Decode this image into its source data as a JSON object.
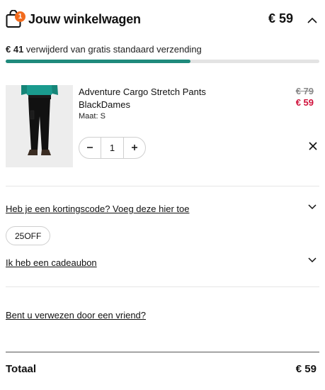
{
  "header": {
    "badge_count": "1",
    "title": "Jouw winkelwagen",
    "total": "€ 59",
    "collapse_icon": "chevron-up-icon"
  },
  "shipping": {
    "amount": "€ 41",
    "message": " verwijderd van gratis standaard verzending",
    "progress_fraction": 0.59,
    "progress_color": "#1f8a7c"
  },
  "item": {
    "name": "Adventure Cargo Stretch Pants BlackDames",
    "size": "Maat: S",
    "price_old": "€ 79",
    "price_new": "€ 59",
    "quantity": "1",
    "decrement_icon": "minus-icon",
    "increment_icon": "plus-icon",
    "remove_icon": "close-icon"
  },
  "discount": {
    "link": "Heb je een kortingscode? Voeg deze hier toe",
    "code": "25OFF"
  },
  "giftcard": {
    "link": "Ik heb een cadeaubon"
  },
  "referral": {
    "link": "Bent u verwezen door een vriend?"
  },
  "totals": {
    "label": "Totaal",
    "value": "€ 59"
  },
  "colors": {
    "accent": "#f26b1d",
    "sale": "#d0103a",
    "progress": "#1f8a7c"
  }
}
